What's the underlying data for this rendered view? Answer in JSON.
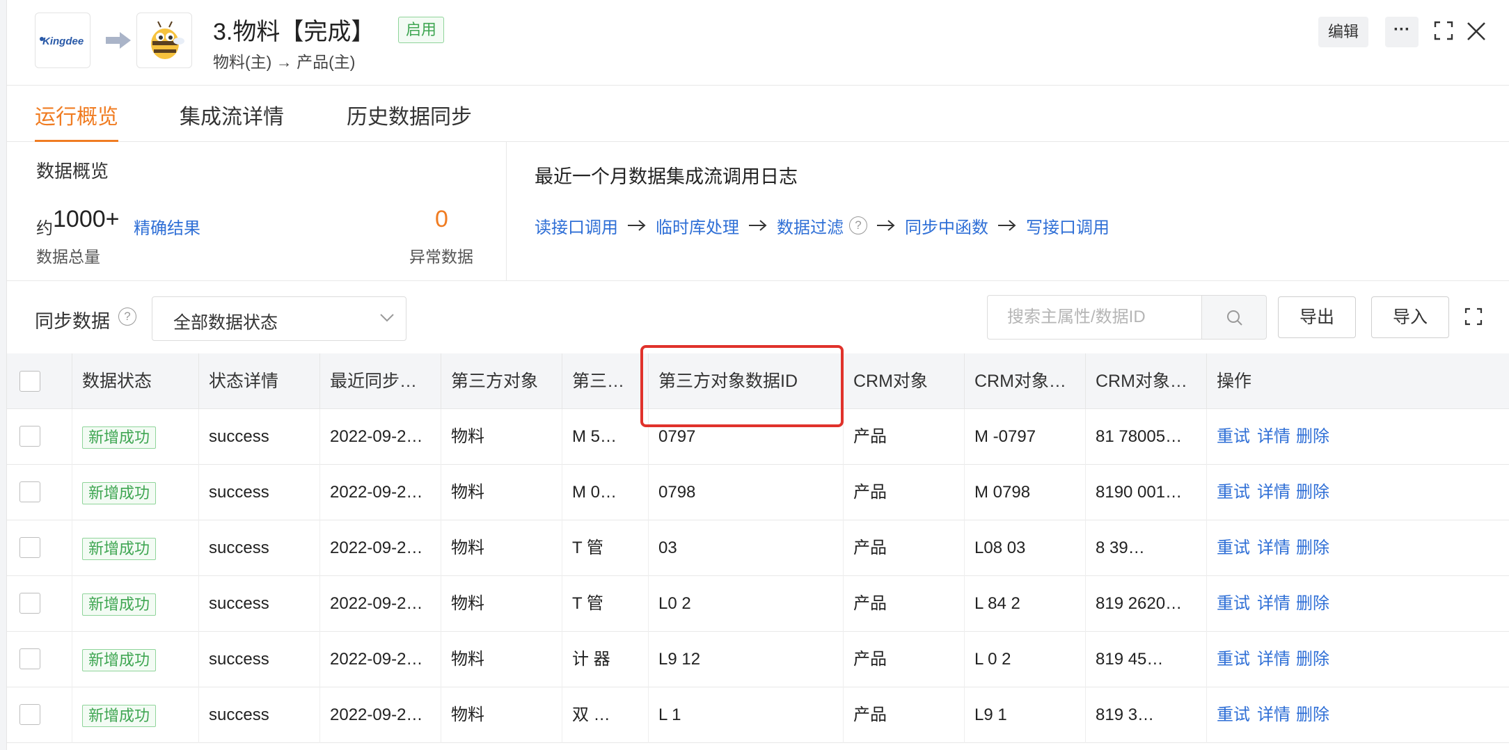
{
  "header": {
    "title": "3.物料【完成】",
    "status_badge": "启用",
    "subtitle": "物料(主)  →  产品(主)",
    "source_logo_text": "Kingdee",
    "source_logo_icon": "kingdee-logo-icon",
    "target_logo_icon": "bee-logo-icon",
    "edit_label": "编辑",
    "more_label": "···"
  },
  "tabs": [
    {
      "label": "运行概览",
      "active": true
    },
    {
      "label": "集成流详情",
      "active": false
    },
    {
      "label": "历史数据同步",
      "active": false
    }
  ],
  "overview": {
    "title": "数据概览",
    "count_prefix": "约",
    "count_value": "1000+",
    "exact_link": "精确结果",
    "total_label": "数据总量",
    "abnormal_value": "0",
    "abnormal_label": "异常数据"
  },
  "log": {
    "title": "最近一个月数据集成流调用日志",
    "steps": [
      "读接口调用",
      "临时库处理",
      "数据过滤",
      "同步中函数",
      "写接口调用"
    ]
  },
  "toolbar": {
    "label": "同步数据",
    "status_select": "全部数据状态",
    "search_placeholder": "搜索主属性/数据ID",
    "export_label": "导出",
    "import_label": "导入"
  },
  "table": {
    "columns": [
      "数据状态",
      "状态详情",
      "最近同步…",
      "第三方对象",
      "第三…",
      "第三方对象数据ID",
      "CRM对象",
      "CRM对象…",
      "CRM对象…",
      "操作"
    ],
    "actions": [
      "重试",
      "详情",
      "删除"
    ],
    "rows": [
      {
        "status": "新增成功",
        "detail": "success",
        "time": "2022-09-2…",
        "third_obj": "物料",
        "third_name": "M 5…",
        "third_id": "0797",
        "crm_obj": "产品",
        "crm_name": "M -0797",
        "crm_id": "81 78005…"
      },
      {
        "status": "新增成功",
        "detail": "success",
        "time": "2022-09-2…",
        "third_obj": "物料",
        "third_name": "M 0…",
        "third_id": "0798",
        "crm_obj": "产品",
        "crm_name": "M 0798",
        "crm_id": "8190 001…"
      },
      {
        "status": "新增成功",
        "detail": "success",
        "time": "2022-09-2…",
        "third_obj": "物料",
        "third_name": "T 管",
        "third_id": "03",
        "crm_obj": "产品",
        "crm_name": "L08 03",
        "crm_id": "8 39…"
      },
      {
        "status": "新增成功",
        "detail": "success",
        "time": "2022-09-2…",
        "third_obj": "物料",
        "third_name": "T 管",
        "third_id": "L0 2",
        "crm_obj": "产品",
        "crm_name": "L 84 2",
        "crm_id": "819 2620…"
      },
      {
        "status": "新增成功",
        "detail": "success",
        "time": "2022-09-2…",
        "third_obj": "物料",
        "third_name": "计 器",
        "third_id": "L9 12",
        "crm_obj": "产品",
        "crm_name": "L 0 2",
        "crm_id": "819 45…"
      },
      {
        "status": "新增成功",
        "detail": "success",
        "time": "2022-09-2…",
        "third_obj": "物料",
        "third_name": "双 …",
        "third_id": "L 1",
        "crm_obj": "产品",
        "crm_name": "L9 1",
        "crm_id": "819 3…"
      }
    ]
  },
  "colors": {
    "accent_orange": "#f07c22",
    "link_blue": "#2f6fd6",
    "success_green": "#3fa652",
    "highlight_red": "#e0322b"
  }
}
